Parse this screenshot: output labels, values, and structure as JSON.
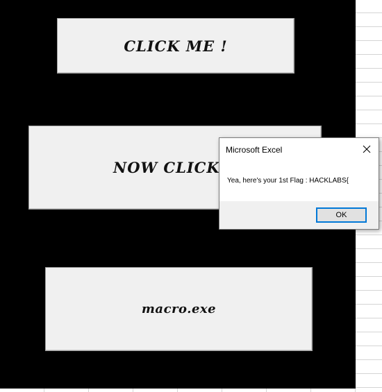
{
  "sheet": {
    "buttons": [
      {
        "label": "CLICK ME !"
      },
      {
        "label": "NOW CLICK ME !"
      },
      {
        "label": "macro.exe"
      }
    ]
  },
  "dialog": {
    "title": "Microsoft Excel",
    "message": "Yea, here's your 1st Flag : HACKLABS{",
    "ok_label": "OK",
    "close_icon": "close-icon"
  },
  "colors": {
    "background": "#000000",
    "button_face": "#f0f0f0",
    "dialog_accent": "#0078d7"
  }
}
